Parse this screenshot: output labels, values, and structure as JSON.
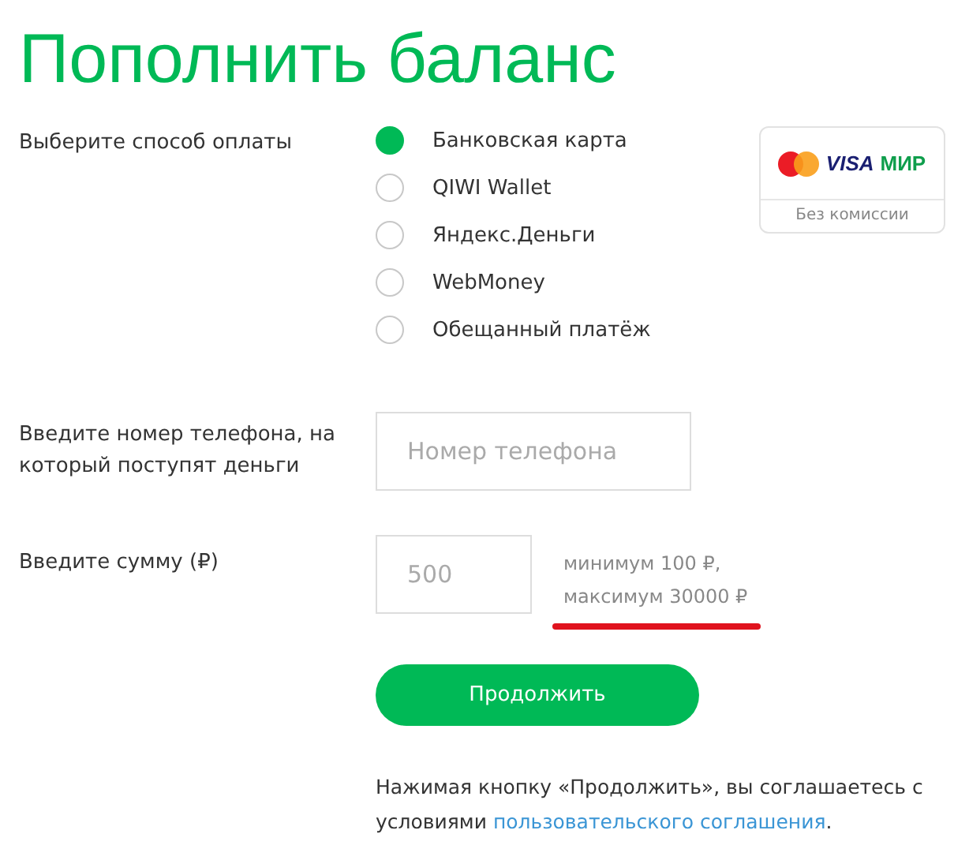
{
  "title": "Пополнить баланс",
  "payment": {
    "label": "Выберите способ оплаты",
    "options": [
      {
        "label": "Банковская карта",
        "selected": true
      },
      {
        "label": "QIWI Wallet",
        "selected": false
      },
      {
        "label": "Яндекс.Деньги",
        "selected": false
      },
      {
        "label": "WebMoney",
        "selected": false
      },
      {
        "label": "Обещанный платёж",
        "selected": false
      }
    ],
    "cards": {
      "logos": [
        "VISA",
        "МИР"
      ],
      "note": "Без комиссии"
    }
  },
  "phone": {
    "label": "Введите номер телефона, на который поступят деньги",
    "placeholder": "Номер телефона"
  },
  "amount": {
    "label": "Введите сумму (₽)",
    "placeholder": "500",
    "hint_lines": [
      "минимум 100 ₽,",
      "максимум 30000 ₽"
    ]
  },
  "submit": "Продолжить",
  "agreement": {
    "text": "Нажимая кнопку «Продолжить», вы соглашаетесь с условиями",
    "link": "пользовательского соглашения",
    "end": "."
  }
}
